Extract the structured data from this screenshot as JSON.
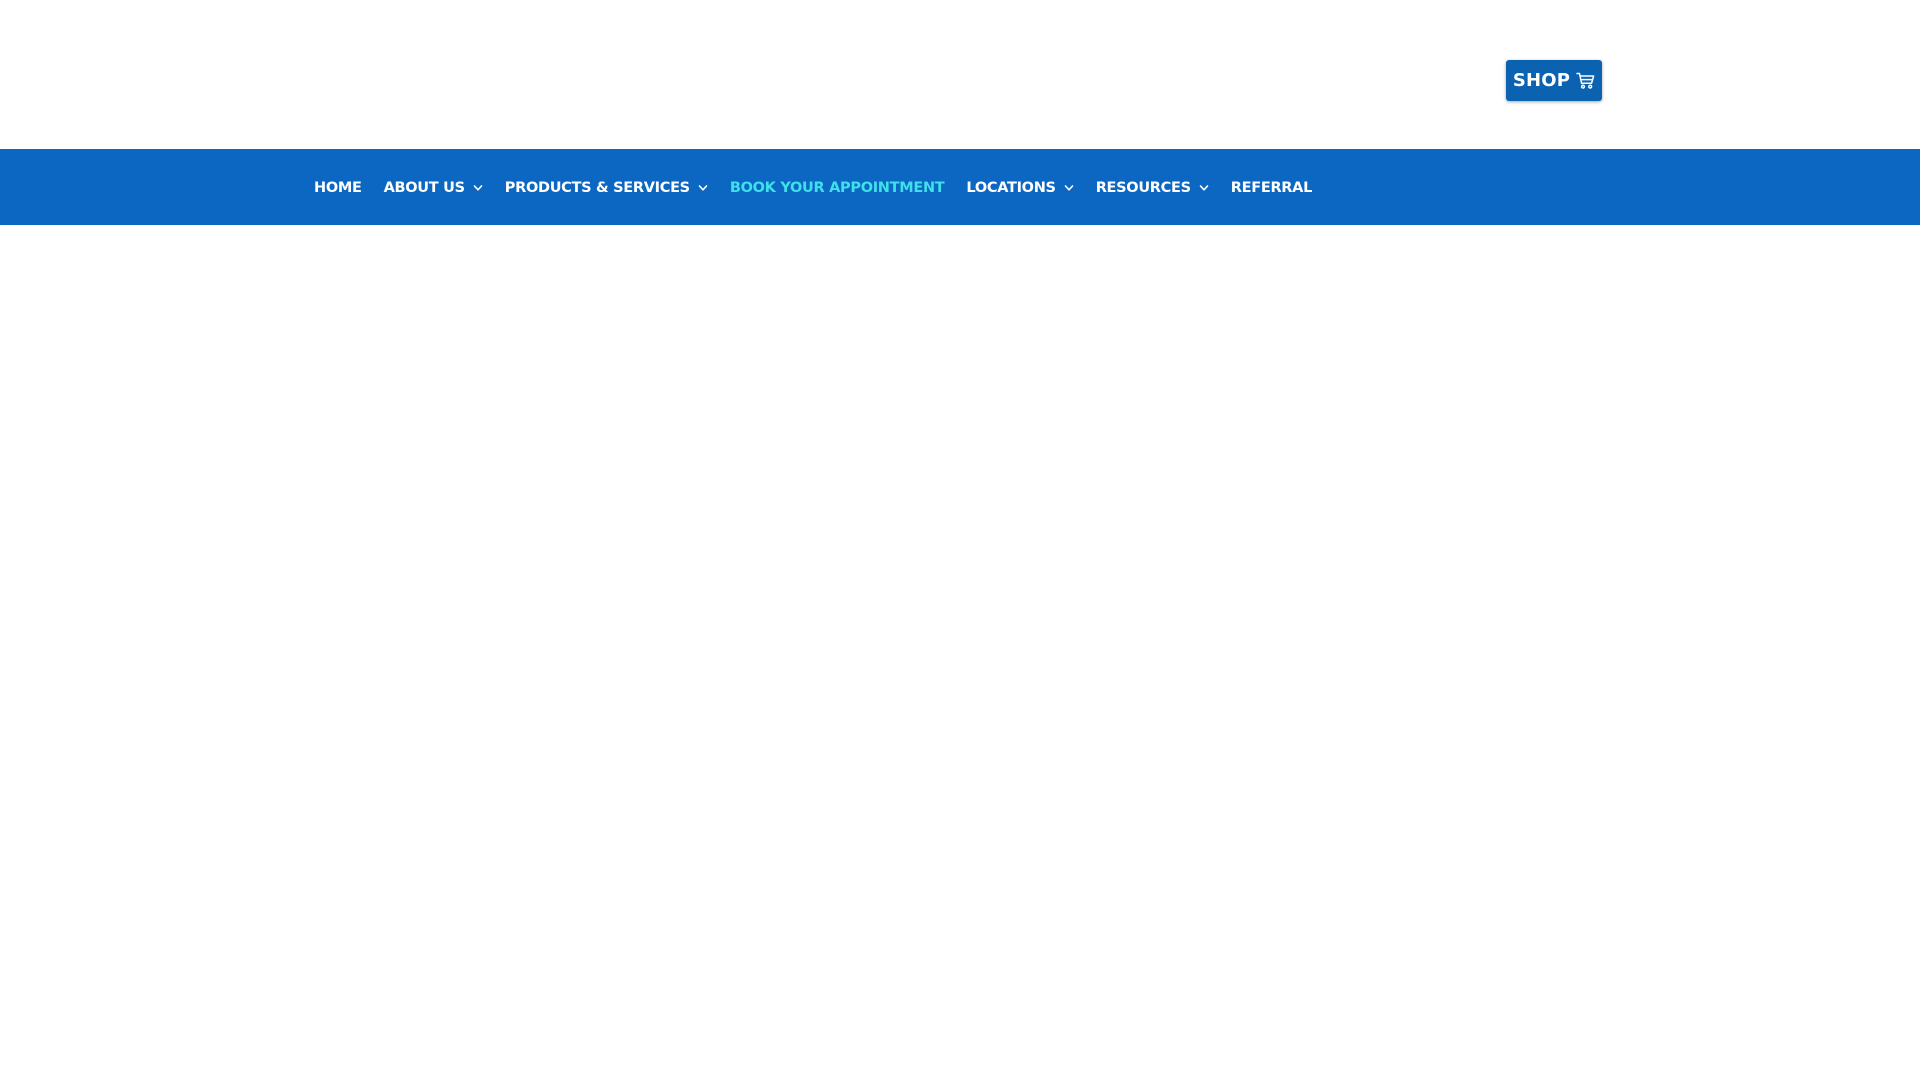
{
  "header": {
    "shop_button": {
      "label": "SHOP",
      "icon": "cart-icon"
    }
  },
  "nav": {
    "items": [
      {
        "label": "HOME",
        "has_dropdown": false,
        "active": false
      },
      {
        "label": "ABOUT US",
        "has_dropdown": true,
        "active": false
      },
      {
        "label": "PRODUCTS & SERVICES",
        "has_dropdown": true,
        "active": false
      },
      {
        "label": "BOOK YOUR APPOINTMENT",
        "has_dropdown": false,
        "active": true
      },
      {
        "label": "LOCATIONS",
        "has_dropdown": true,
        "active": false
      },
      {
        "label": "RESOURCES",
        "has_dropdown": true,
        "active": false
      },
      {
        "label": "REFERRAL",
        "has_dropdown": false,
        "active": false
      }
    ]
  },
  "colors": {
    "nav_background": "#0b67c2",
    "shop_button_background": "#0a62b0",
    "nav_text": "#ffffff",
    "nav_active_text": "#3ee0ea",
    "page_background": "#ffffff"
  }
}
